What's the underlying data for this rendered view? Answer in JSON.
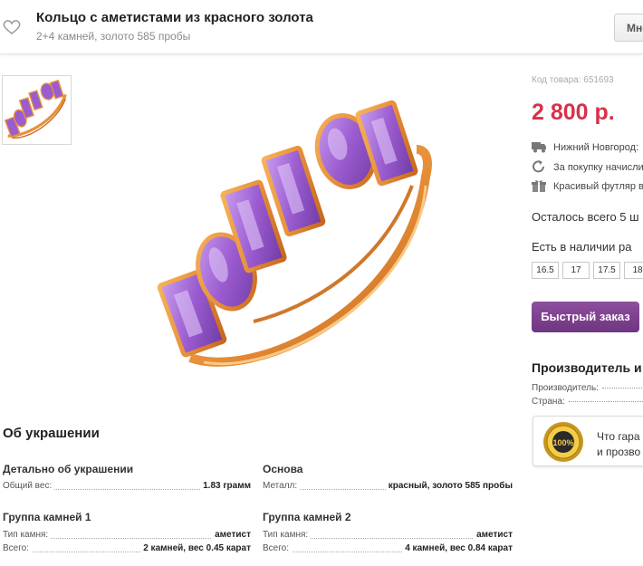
{
  "header": {
    "title": "Кольцо с аметистами из красного золота",
    "subtitle": "2+4 камней, золото 585 пробы",
    "more_button": "Мно"
  },
  "product": {
    "sku": "Код товара: 651693",
    "price": "2 800 р.",
    "info": [
      {
        "icon": "truck-icon",
        "text": "Нижний Новгород:"
      },
      {
        "icon": "refresh-icon",
        "text": "За покупку начисли"
      },
      {
        "icon": "gift-icon",
        "text": "Красивый футляр в"
      }
    ],
    "stock": "Осталось всего 5 ш",
    "availability": "Есть в наличии ра",
    "sizes": [
      "16.5",
      "17",
      "17.5",
      "18"
    ],
    "quick_order": "Быстрый заказ",
    "maker_title": "Производитель и",
    "maker_fields": [
      "Производитель:",
      "Страна:"
    ],
    "guarantee_lines": [
      "Что гара",
      "и прозво"
    ],
    "seal_text": "100%"
  },
  "about": {
    "title": "Об украшении",
    "blocks": [
      {
        "title": "Детально об украшении",
        "rows": [
          {
            "k": "Общий вес:",
            "v": "1.83 грамм"
          }
        ]
      },
      {
        "title": "Основа",
        "rows": [
          {
            "k": "Металл:",
            "v": "красный, золото 585 пробы"
          }
        ]
      },
      {
        "title": "Группа камней 1",
        "rows": [
          {
            "k": "Тип камня:",
            "v": "аметист"
          },
          {
            "k": "Всего:",
            "v": "2 камней, вес 0.45 карат"
          }
        ]
      },
      {
        "title": "Группа камней 2",
        "rows": [
          {
            "k": "Тип камня:",
            "v": "аметист"
          },
          {
            "k": "Всего:",
            "v": "4 камней, вес 0.84 карат"
          }
        ]
      }
    ]
  },
  "colors": {
    "price": "#d9304a",
    "accent": "#7a3d8b",
    "gold": "#e8913a",
    "amethyst": "#9b5cd0"
  }
}
